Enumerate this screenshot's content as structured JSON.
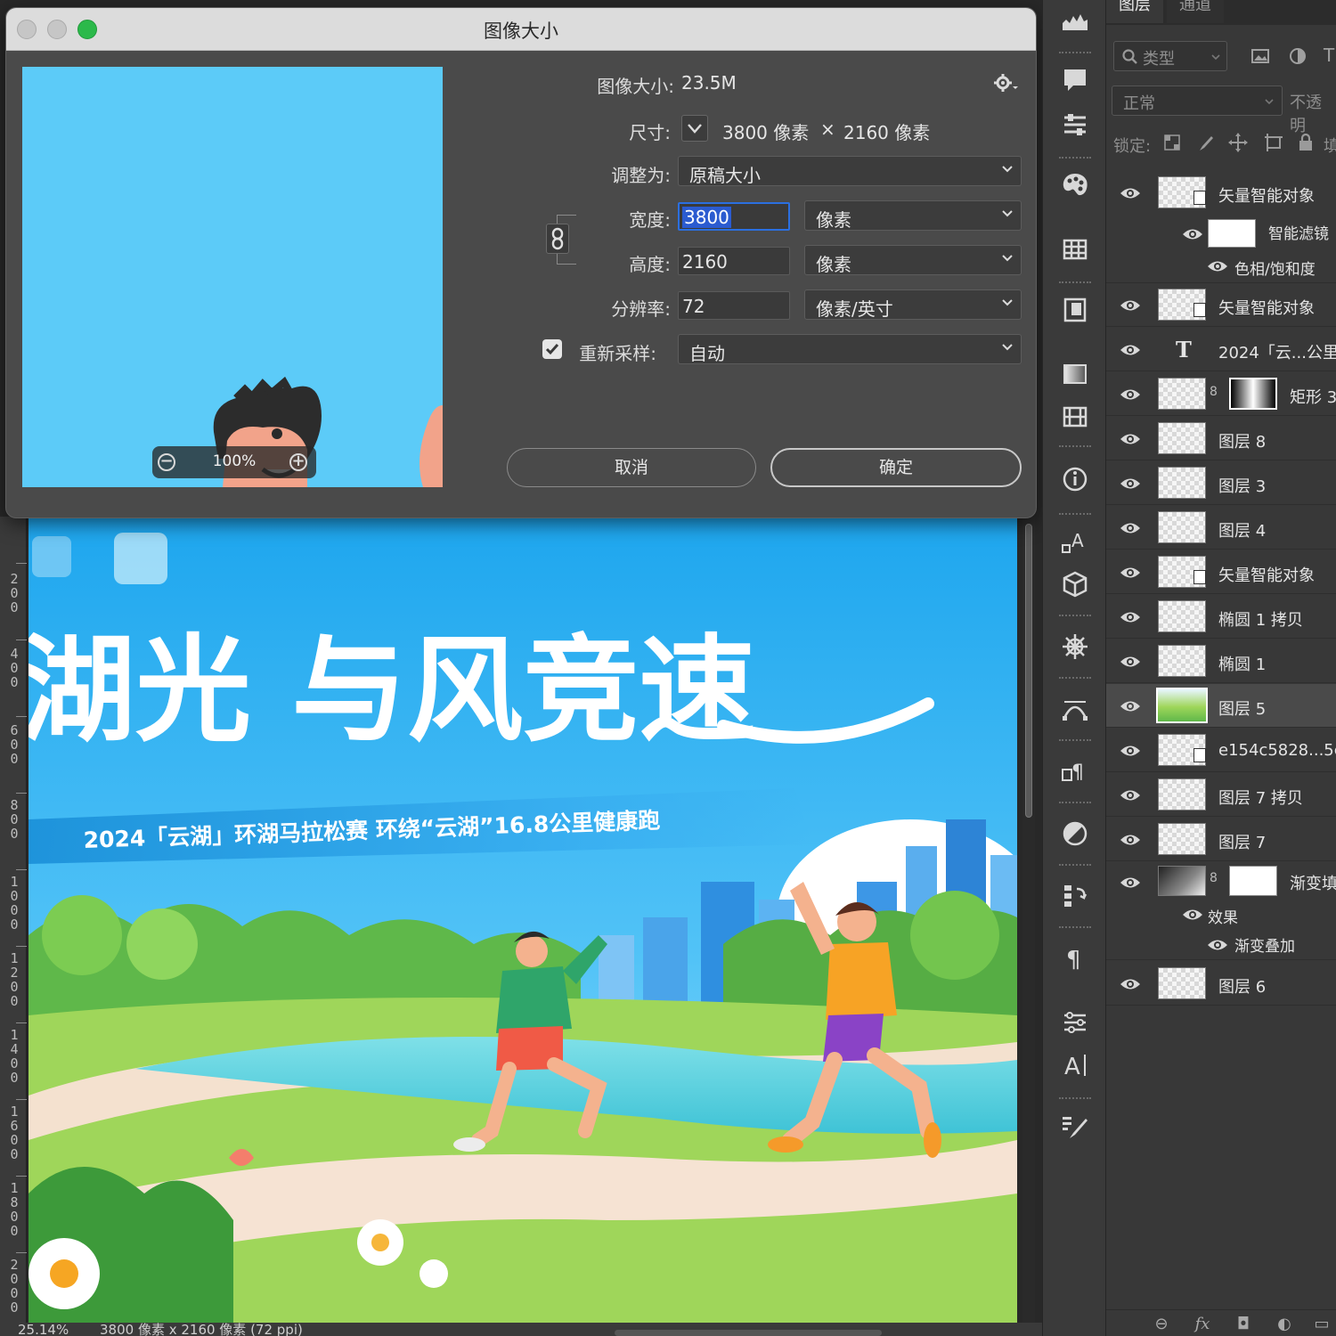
{
  "dialog": {
    "title": "图像大小",
    "image_size_label": "图像大小:",
    "image_size_value": "23.5M",
    "dimensions_label": "尺寸:",
    "dimensions_width": "3800 像素",
    "dimensions_x": "×",
    "dimensions_height": "2160 像素",
    "fit_to_label": "调整为:",
    "fit_to_value": "原稿大小",
    "width_label": "宽度:",
    "width_value": "3800",
    "width_unit": "像素",
    "height_label": "高度:",
    "height_value": "2160",
    "height_unit": "像素",
    "resolution_label": "分辨率:",
    "resolution_value": "72",
    "resolution_unit": "像素/英寸",
    "resample_label": "重新采样:",
    "resample_checked": true,
    "resample_value": "自动",
    "preview_zoom": "100%",
    "cancel_label": "取消",
    "ok_label": "确定"
  },
  "artwork": {
    "headline": "湖光  与风竞速",
    "subtitle": "2024「云湖」环湖马拉松赛  环绕“云湖”16.8公里健康跑"
  },
  "ruler": {
    "labels": [
      "200",
      "400",
      "600",
      "800",
      "1000",
      "1200",
      "1400",
      "1600",
      "1800",
      "2000"
    ]
  },
  "status": {
    "zoom": "25.14%",
    "doc_info": "3800 像素 x 2160 像素 (72 ppi)"
  },
  "layers_panel": {
    "tabs": [
      "图层",
      "通道"
    ],
    "filter_label": "类型",
    "blend_mode": "正常",
    "opacity_label": "不透明",
    "lock_label": "锁定:",
    "layers": [
      {
        "name": "矢量智能对象",
        "type": "smart"
      },
      {
        "name": "智能滤镜",
        "type": "smart-filter"
      },
      {
        "name": "色相/饱和度",
        "type": "filter-item"
      },
      {
        "name": "矢量智能对象",
        "type": "smart"
      },
      {
        "name": "2024「云...公里",
        "type": "text"
      },
      {
        "name": "矩形 3",
        "type": "shape-mask"
      },
      {
        "name": "图层 8",
        "type": "pixel"
      },
      {
        "name": "图层 3",
        "type": "pixel"
      },
      {
        "name": "图层 4",
        "type": "pixel"
      },
      {
        "name": "矢量智能对象",
        "type": "smart"
      },
      {
        "name": "椭圆 1 拷贝",
        "type": "pixel"
      },
      {
        "name": "椭圆 1",
        "type": "pixel"
      },
      {
        "name": "图层 5",
        "type": "pixel",
        "selected": true
      },
      {
        "name": "e154c5828...5c",
        "type": "smart"
      },
      {
        "name": "图层 7 拷贝",
        "type": "pixel"
      },
      {
        "name": "图层 7",
        "type": "pixel"
      },
      {
        "name": "渐变填充",
        "type": "gradient"
      },
      {
        "name": "效果",
        "type": "effects"
      },
      {
        "name": "渐变叠加",
        "type": "effect-item"
      },
      {
        "name": "图层 6",
        "type": "pixel"
      }
    ]
  },
  "colors": {
    "dialog_bg": "#4a4a4a",
    "panel_bg": "#383838",
    "sky": "#5ccbf8",
    "accent_focus": "#2b6fe0",
    "traffic_green": "#2bb94a"
  }
}
